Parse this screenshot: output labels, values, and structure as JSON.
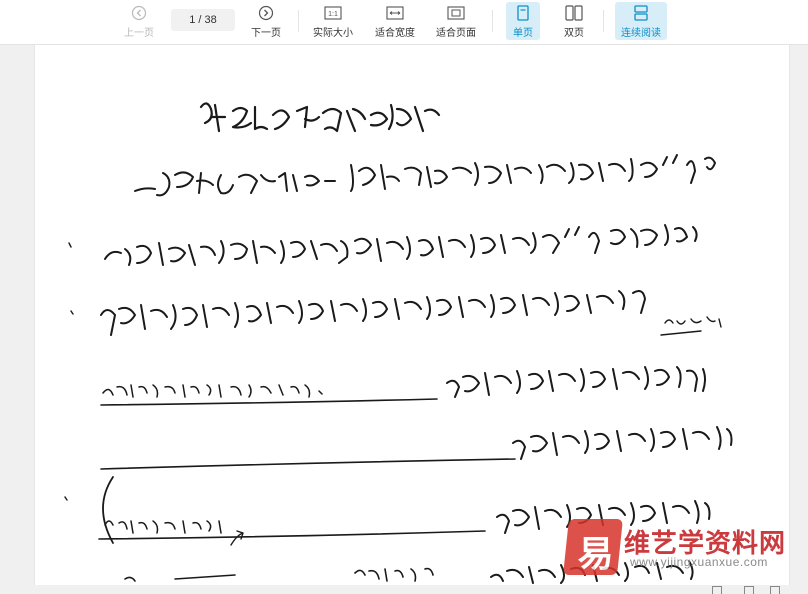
{
  "toolbar": {
    "prev_label": "上一页",
    "next_label": "下一页",
    "page_value": "1 / 38",
    "actual_size_label": "实际大小",
    "fit_width_label": "适合宽度",
    "fit_page_label": "适合页面",
    "single_label": "单页",
    "double_label": "双页",
    "continuous_label": "连续阅读",
    "actual_size_glyph": "1:1"
  },
  "watermark": {
    "title": "维艺学资料网",
    "url": "www.yijingxuanxue.com"
  },
  "colors": {
    "accent": "#0d8ec7",
    "active_bg": "#d7eef9",
    "ink": "#1a1a1a",
    "watermark_red": "#c6262a"
  }
}
